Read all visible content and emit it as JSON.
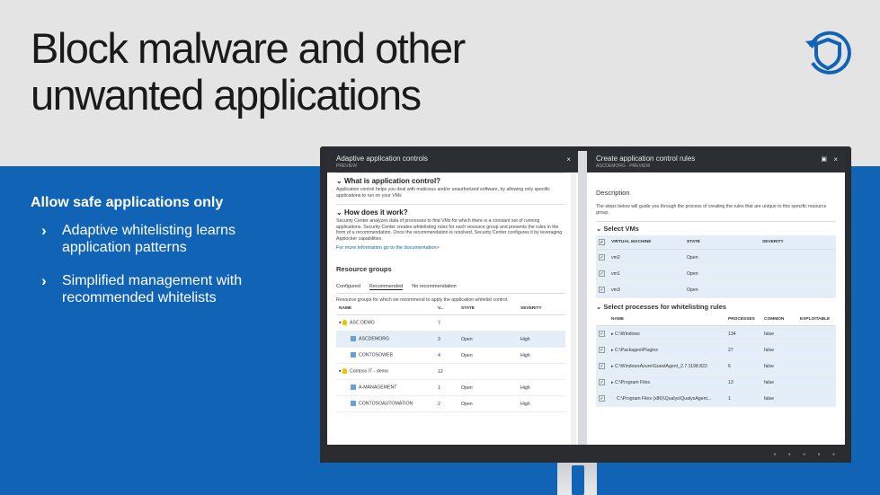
{
  "slide": {
    "title_line1": "Block malware and other",
    "title_line2": "unwanted applications",
    "bullets_heading": "Allow safe applications only",
    "bullets": [
      "Adaptive whitelisting learns application patterns",
      "Simplified management with recommended whitelists"
    ],
    "colors": {
      "accent": "#1063b5",
      "background": "#e4e4e4"
    },
    "logo_icon": "security-center-shield-icon"
  },
  "left_blade": {
    "title": "Adaptive application controls",
    "subtitle": "PREVIEW",
    "close_icon": "×",
    "what_heading": "What is application control?",
    "what_text": "Application control helps you deal with malicious and/or unauthorized software, by allowing only specific applications to run on your VMs",
    "how_heading": "How does it work?",
    "how_text": "Security Center analyzes data of processes to find VMs for which there is a constant set of running applications. Security Center creates whitelisting rules for each resource group and presents the rules in the form of a recommendation. Once the recommendation is resolved, Security Center configures it by leveraging Applocker capabilities.",
    "more_link": "For more information go to the documentation>",
    "resource_groups_heading": "Resource groups",
    "tabs": [
      "Configured",
      "Recommended",
      "No recommendation"
    ],
    "active_tab": "Recommended",
    "tab_desc": "Resource groups for which we recommend to apply the application whitelist control.",
    "columns": [
      "NAME",
      "V...",
      "STATE",
      "SEVERITY"
    ],
    "rows": [
      {
        "name": "ASC DEMO",
        "vms": "7",
        "state": "",
        "severity": "",
        "kind": "group"
      },
      {
        "name": "ASCDEMORG",
        "vms": "3",
        "state": "Open",
        "severity": "High",
        "kind": "rg",
        "hl": true
      },
      {
        "name": "CONTOSOWEB",
        "vms": "4",
        "state": "Open",
        "severity": "High",
        "kind": "rg"
      },
      {
        "name": "Contoso IT - demo",
        "vms": "12",
        "state": "",
        "severity": "",
        "kind": "group"
      },
      {
        "name": "A-MANAGEMENT",
        "vms": "1",
        "state": "Open",
        "severity": "High",
        "kind": "rg"
      },
      {
        "name": "CONTOSOAUTOMATION",
        "vms": "2",
        "state": "Open",
        "severity": "High",
        "kind": "rg"
      }
    ]
  },
  "right_blade": {
    "title": "Create application control rules",
    "subtitle": "ASCDEMORG - PREVIEW",
    "close_icon": "×",
    "maximize_icon": "▣",
    "description_heading": "Description",
    "description_text": "The steps below will guide you through the process of creating the rules that are unique to this specific resource group.",
    "select_vms_heading": "Select VMs",
    "vm_columns": [
      "VIRTUAL MACHINE",
      "STATE",
      "SEVERITY"
    ],
    "vms": [
      {
        "name": "vm2",
        "state": "Open"
      },
      {
        "name": "vm1",
        "state": "Open"
      },
      {
        "name": "vm3",
        "state": "Open"
      }
    ],
    "processes_heading": "Select processes for whitelisting rules",
    "proc_columns": [
      "NAME",
      "PROCESSES",
      "COMMON",
      "EXPLOITABLE"
    ],
    "processes": [
      {
        "name": "C:\\Windows",
        "processes": "134",
        "common": "false",
        "expand": true
      },
      {
        "name": "C:\\Packages\\Plugins",
        "processes": "27",
        "common": "false",
        "expand": true
      },
      {
        "name": "C:\\WindowsAzure\\GuestAgent_2.7.1198.822",
        "processes": "6",
        "common": "false",
        "expand": true
      },
      {
        "name": "C:\\Program Files",
        "processes": "13",
        "common": "false",
        "expand": true
      },
      {
        "name": "C:\\Program Files (x86)\\Qualys\\QualysAgent...",
        "processes": "1",
        "common": "false",
        "expand": false
      }
    ]
  }
}
